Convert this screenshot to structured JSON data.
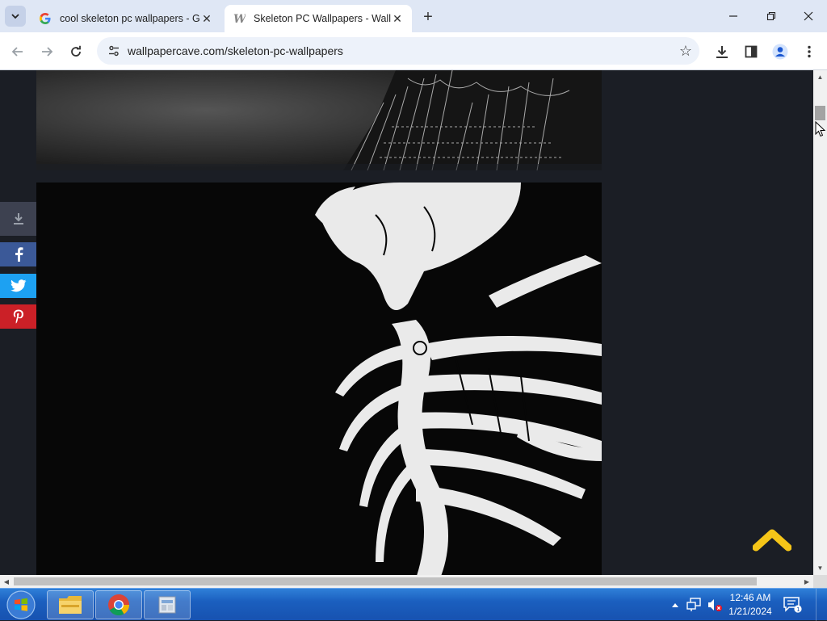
{
  "browser": {
    "tabs": [
      {
        "title": "cool skeleton pc wallpapers - Google Search",
        "favicon": "google-g-icon",
        "active": false
      },
      {
        "title": "Skeleton PC Wallpapers - WallpaperCave",
        "favicon": "wallpapercave-w-icon",
        "active": true
      }
    ],
    "url": "wallpapercave.com/skeleton-pc-wallpapers"
  },
  "page": {
    "share_buttons": [
      "download-icon",
      "facebook-icon",
      "twitter-icon",
      "pinterest-icon"
    ],
    "images": [
      "Dark gothic architecture wallpaper (partial)",
      "Black and white skeleton creature illustration"
    ],
    "accent_color": "#f5c518"
  },
  "taskbar": {
    "apps": [
      "file-explorer-icon",
      "chrome-icon",
      "control-panel-icon"
    ],
    "time": "12:46 AM",
    "date": "1/21/2024"
  }
}
